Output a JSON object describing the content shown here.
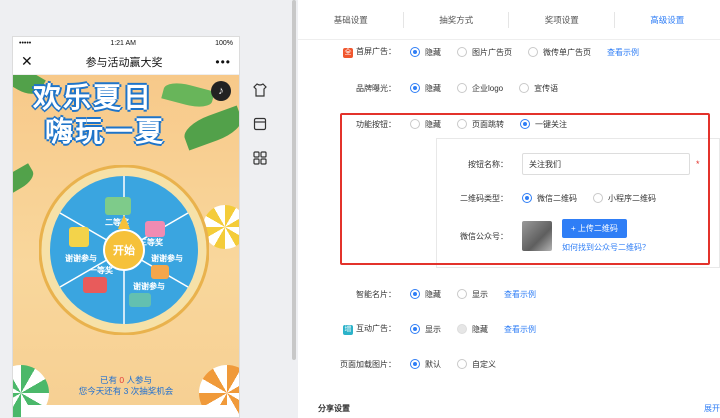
{
  "phone": {
    "status": {
      "carrier": "•••••",
      "time": "1:21 AM",
      "battery": "100%"
    },
    "nav_title": "参与活动赢大奖",
    "close_label": "✕",
    "more_label": "•••",
    "headline_line1": "欢乐夏日",
    "headline_line2": "嗨玩一夏",
    "music_icon": "♪",
    "wheel_center": "开始",
    "wheel_prizes": [
      "二等奖",
      "三等奖",
      "谢谢参与",
      "谢谢参与",
      "一等奖",
      "谢谢参与"
    ],
    "info_line1_pre": "已有",
    "info_line1_num": "0",
    "info_line1_post": "人参与",
    "info_line2": "您今天还有 3 次抽奖机会"
  },
  "side_icons": [
    "shirt-icon",
    "calendar-icon",
    "grid-icon"
  ],
  "tabs": [
    "基础设置",
    "抽奖方式",
    "奖项设置",
    "高级设置"
  ],
  "active_tab": "高级设置",
  "settings": {
    "first_screen_ad": {
      "label": "首屏广告：",
      "options": [
        "隐藏",
        "图片广告页",
        "微传单广告页"
      ],
      "selected": "隐藏",
      "link": "查看示例"
    },
    "brand_exposure": {
      "label": "品牌曝光：",
      "options": [
        "隐藏",
        "企业logo",
        "宣传语"
      ],
      "selected": "隐藏"
    },
    "function_button": {
      "label": "功能按钮：",
      "options": [
        "隐藏",
        "页面跳转",
        "一键关注"
      ],
      "selected": "一键关注"
    },
    "button_name": {
      "label": "按钮名称：",
      "value": "关注我们",
      "required": "*"
    },
    "qr_type": {
      "label": "二维码类型：",
      "options": [
        "微信二维码",
        "小程序二维码"
      ],
      "selected": "微信二维码"
    },
    "wechat_account": {
      "label": "微信公众号：",
      "upload": "+ 上传二维码",
      "help": "如何找到公众号二维码？"
    },
    "smart_card": {
      "label": "智能名片：",
      "options": [
        "隐藏",
        "显示"
      ],
      "selected": "隐藏",
      "link": "查看示例"
    },
    "interactive_ad": {
      "label": "互动广告：",
      "options": [
        "显示",
        "隐藏"
      ],
      "selected": "显示",
      "link": "查看示例"
    },
    "page_loading_image": {
      "label": "页面加载图片：",
      "options": [
        "默认",
        "自定义"
      ],
      "selected": "默认"
    }
  },
  "share_section": {
    "title": "分享设置",
    "expand": "展开"
  },
  "colors": {
    "accent": "#2f7ef6",
    "highlight_border": "#e3322b"
  }
}
